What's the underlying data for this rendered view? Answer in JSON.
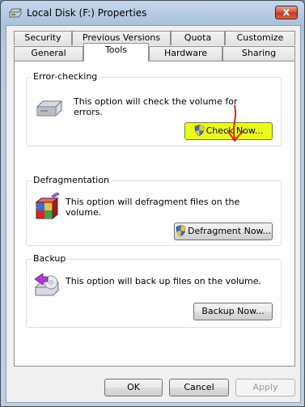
{
  "window": {
    "title": "Local Disk (F:) Properties",
    "close_glyph": "x",
    "title_icon": "drive-icon"
  },
  "tabs": {
    "row_back": [
      "Security",
      "Previous Versions",
      "Quota",
      "Customize"
    ],
    "row_front": [
      "General",
      "Tools",
      "Hardware",
      "Sharing"
    ],
    "active": "Tools"
  },
  "error_checking": {
    "heading": "Error-checking",
    "description": "This option will check the volume for errors.",
    "button": "Check Now...",
    "icon": "disk-check-icon",
    "annotation": "red-arrow-pointing-down"
  },
  "defragmentation": {
    "heading": "Defragmentation",
    "description": "This option will defragment files on the volume.",
    "button": "Defragment Now...",
    "icon": "defrag-icon"
  },
  "backup": {
    "heading": "Backup",
    "description": "This option will back up files on the volume.",
    "button": "Backup Now...",
    "icon": "backup-icon"
  },
  "footer": {
    "ok": "OK",
    "cancel": "Cancel",
    "apply": "Apply"
  },
  "colors": {
    "highlight": "#e9fb17",
    "close_red": "#c13920",
    "arrow_red": "#e0241b"
  }
}
